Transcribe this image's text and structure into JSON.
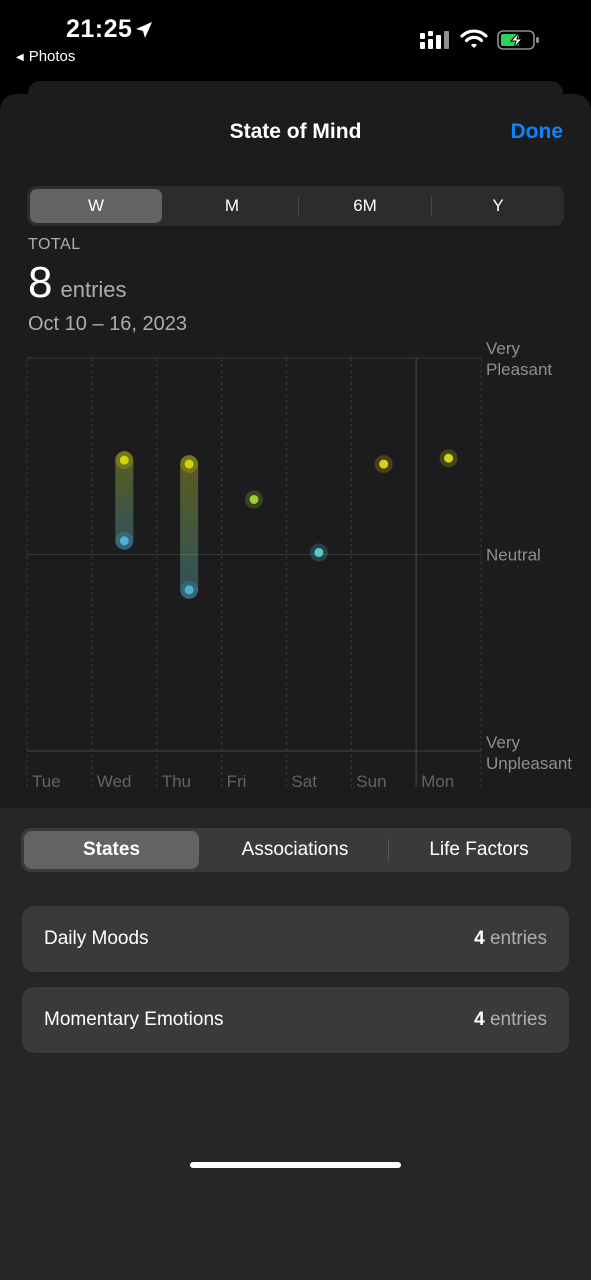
{
  "status_bar": {
    "time": "21:25",
    "back_app": "Photos"
  },
  "sheet": {
    "title": "State of Mind",
    "done_label": "Done"
  },
  "range_tabs": [
    {
      "label": "W",
      "active": true
    },
    {
      "label": "M",
      "active": false
    },
    {
      "label": "6M",
      "active": false
    },
    {
      "label": "Y",
      "active": false
    }
  ],
  "summary": {
    "total_label": "TOTAL",
    "count": "8",
    "count_unit": "entries",
    "date_range": "Oct 10 – 16, 2023"
  },
  "chart_data": {
    "type": "scatter",
    "categories": [
      "Tue",
      "Wed",
      "Thu",
      "Fri",
      "Sat",
      "Sun",
      "Mon"
    ],
    "y_scale_labels": {
      "top": [
        "Very",
        "Pleasant"
      ],
      "middle": "Neutral",
      "bottom": [
        "Very",
        "Unpleasant"
      ]
    },
    "ylim": [
      -1,
      1
    ],
    "grid": true,
    "points": [
      {
        "day": "Wed",
        "value": 0.48,
        "color": "#d4d414"
      },
      {
        "day": "Wed",
        "value": 0.07,
        "color": "#4fb3d6"
      },
      {
        "day": "Thu",
        "value": 0.46,
        "color": "#d4d414"
      },
      {
        "day": "Thu",
        "value": -0.18,
        "color": "#4fb3d6"
      },
      {
        "day": "Fri",
        "value": 0.28,
        "color": "#9bd22c"
      },
      {
        "day": "Sat",
        "value": 0.01,
        "color": "#5ac8c8"
      },
      {
        "day": "Sun",
        "value": 0.46,
        "color": "#d4d414"
      },
      {
        "day": "Mon",
        "value": 0.49,
        "color": "#d4d414"
      }
    ],
    "ranges": [
      {
        "day": "Wed",
        "from": 0.07,
        "to": 0.48
      },
      {
        "day": "Thu",
        "from": -0.18,
        "to": 0.46
      }
    ]
  },
  "category_tabs": [
    {
      "label": "States",
      "active": true
    },
    {
      "label": "Associations",
      "active": false
    },
    {
      "label": "Life Factors",
      "active": false
    }
  ],
  "rows": [
    {
      "label": "Daily Moods",
      "count": "4",
      "unit": "entries"
    },
    {
      "label": "Momentary Emotions",
      "count": "4",
      "unit": "entries"
    }
  ]
}
